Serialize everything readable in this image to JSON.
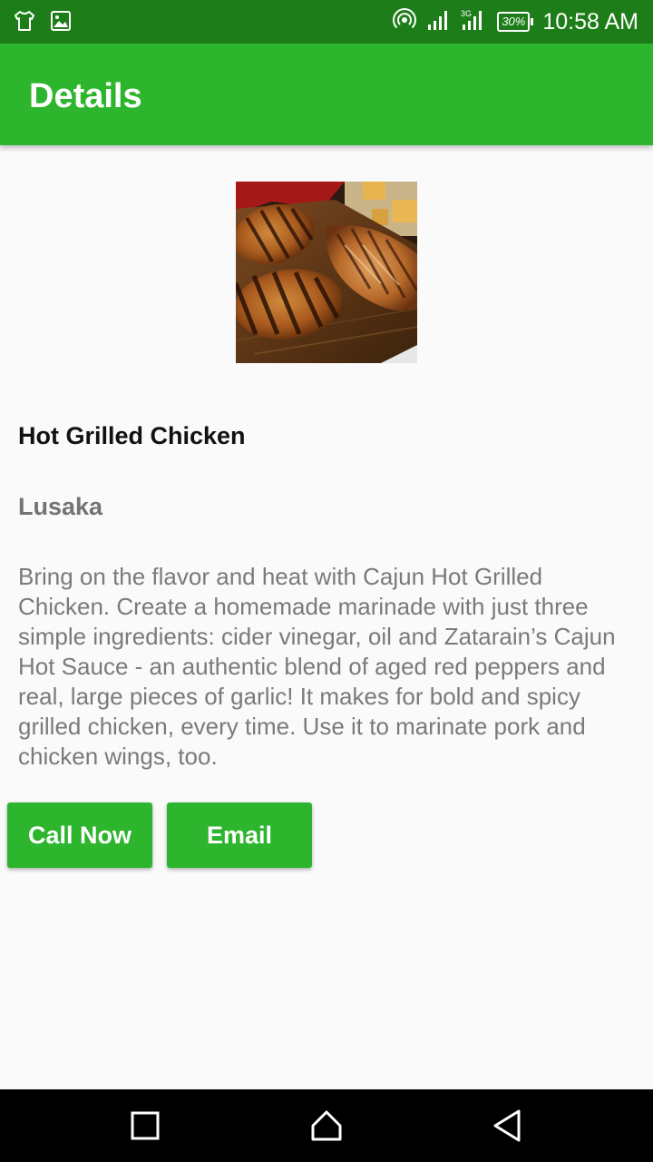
{
  "status_bar": {
    "battery": "30%",
    "network": "3G",
    "time": "10:58 AM",
    "icons": [
      "shirt-icon",
      "image-icon",
      "hotspot-icon",
      "signal-icon",
      "signal-3g-icon",
      "battery-icon"
    ]
  },
  "app_bar": {
    "title": "Details"
  },
  "item": {
    "image_icon": "grilled-chicken-photo",
    "title": "Hot Grilled Chicken",
    "location": "Lusaka",
    "description": "Bring on the flavor and heat with Cajun Hot Grilled Chicken. Create a homemade marinade with just three simple ingredients: cider vinegar, oil and Zatarain’s Cajun Hot Sauce - an authentic blend of aged red peppers and real, large pieces of garlic! It makes for bold and spicy grilled chicken, every time. Use it to marinate pork and chicken wings, too."
  },
  "actions": {
    "call_label": "Call Now",
    "email_label": "Email"
  },
  "nav_bar": {
    "icons": [
      "recent-apps-icon",
      "home-icon",
      "back-icon"
    ]
  },
  "colors": {
    "status_bar": "#1d7e19",
    "primary": "#2db52d",
    "background": "#fafafa",
    "title_text": "#111111",
    "secondary_text": "#737373"
  }
}
